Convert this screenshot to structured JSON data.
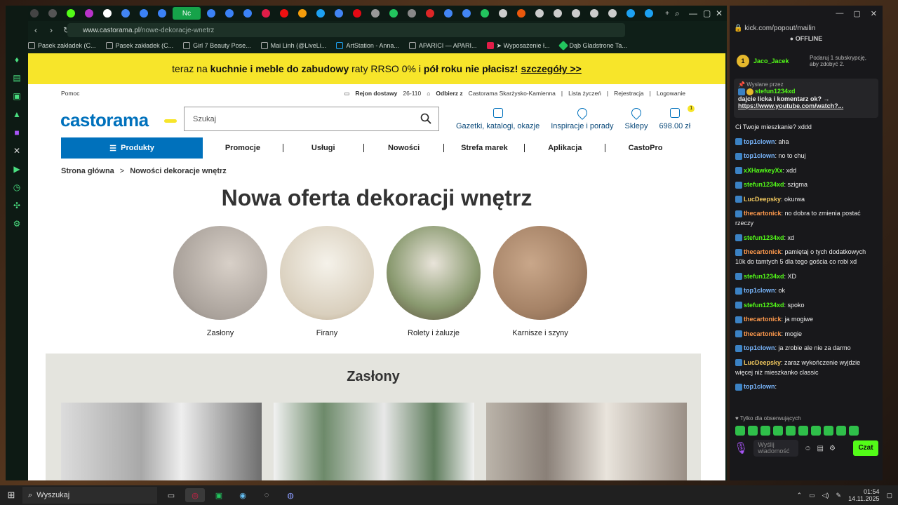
{
  "browser": {
    "url_host": "www.castorama.pl",
    "url_path": "/nowe-dekoracje-wnetrz",
    "active_tab_label": "Nc",
    "bookmarks": [
      "Pasek zakładek (C...",
      "Pasek zakładek (C...",
      "Girl 7 Beauty Pose...",
      "Mai Linh (@LiveLi...",
      "ArtStation - Anna...",
      "APARICI — APARI...",
      "➤ Wyposażenie ł...",
      "Dąb Gladstrone Ta..."
    ]
  },
  "promo": {
    "pre": "teraz na",
    "bold": "kuchnie i meble do zabudowy",
    "mid": "raty RRSO 0% i",
    "bold2": "pół roku nie płacisz!",
    "link": "szczegóły >>"
  },
  "util": {
    "help": "Pomoc",
    "delivery": "Rejon dostawy",
    "zip": "26-110",
    "pickup": "Odbierz z",
    "store": "Castorama Skarżysko-Kamienna",
    "wishlist": "Lista życzeń",
    "register": "Rejestracja",
    "login": "Logowanie"
  },
  "logo": "castorama",
  "search": {
    "placeholder": "Szukaj"
  },
  "header_links": [
    "Gazetki, katalogi, okazje",
    "Inspiracje i porady",
    "Sklepy"
  ],
  "cart": {
    "count": "1",
    "total": "698.00 zł"
  },
  "nav": {
    "products": "Produkty",
    "items": [
      "Promocje",
      "Usługi",
      "Nowości",
      "Strefa marek",
      "Aplikacja",
      "CastoPro"
    ]
  },
  "breadcrumb": {
    "home": "Strona główna",
    "sep": ">",
    "current": "Nowości dekoracje wnętrz"
  },
  "page_title": "Nowa oferta dekoracji wnętrz",
  "categories": [
    "Zasłony",
    "Firany",
    "Rolety i żaluzje",
    "Karnisze i szyny"
  ],
  "section_title": "Zasłony",
  "kick": {
    "url": "kick.com/popout/mailin",
    "status": "OFFLINE",
    "top_user": "Jaco_Jacek",
    "top_count": "1",
    "top_right": "Podaruj 1 subskrypcję, aby zdobyć 2.",
    "pinned_header": "Wysłane przez",
    "pinned_user": "stefun1234xd",
    "pinned_text": "dajcie licka i komentarz ok? →",
    "pinned_link": "https://www.youtube.com/watch?...",
    "messages": [
      {
        "user": "",
        "text": "Ci Twoje mieszkanie? xddd",
        "color": "#eeeeee"
      },
      {
        "user": "top1clown",
        "text": "aha",
        "color": "#7ab8ff"
      },
      {
        "user": "top1clown",
        "text": "no to chuj",
        "color": "#7ab8ff"
      },
      {
        "user": "xXHawkeyXx",
        "text": "xdd",
        "color": "#53fc18"
      },
      {
        "user": "stefun1234xd",
        "text": "szigma",
        "color": "#53fc18"
      },
      {
        "user": "LucDeepsky",
        "text": "okurwa",
        "color": "#f0c75e"
      },
      {
        "user": "thecartonick",
        "text": "no dobra to zmienia postać rzeczy",
        "color": "#ff9a4d"
      },
      {
        "user": "stefun1234xd",
        "text": "xd",
        "color": "#53fc18"
      },
      {
        "user": "thecartonick",
        "text": "pamiętaj o tych dodatkowych 10k do tamtych 5 dla tego gościa co robi xd",
        "color": "#ff9a4d"
      },
      {
        "user": "stefun1234xd",
        "text": "XD",
        "color": "#53fc18"
      },
      {
        "user": "top1clown",
        "text": "ok",
        "color": "#7ab8ff"
      },
      {
        "user": "stefun1234xd",
        "text": "spoko",
        "color": "#53fc18"
      },
      {
        "user": "thecartonick",
        "text": "ja mogiwe",
        "color": "#ff9a4d"
      },
      {
        "user": "thecartonick",
        "text": "mogie",
        "color": "#ff9a4d"
      },
      {
        "user": "top1clown",
        "text": "ja zrobie ale nie za darmo",
        "color": "#7ab8ff"
      },
      {
        "user": "LucDeepsky",
        "text": "zaraz wykończenie wyjdzie więcej niż mieszkanko classic",
        "color": "#f0c75e"
      },
      {
        "user": "top1clown",
        "text": "",
        "color": "#7ab8ff"
      }
    ],
    "followers_only": "Tylko dla obserwujących",
    "input_placeholder": "Wyślij wiadomość",
    "send": "Czat"
  },
  "taskbar": {
    "search": "Wyszukaj",
    "time": "01:54",
    "date": "14.11.2025"
  }
}
